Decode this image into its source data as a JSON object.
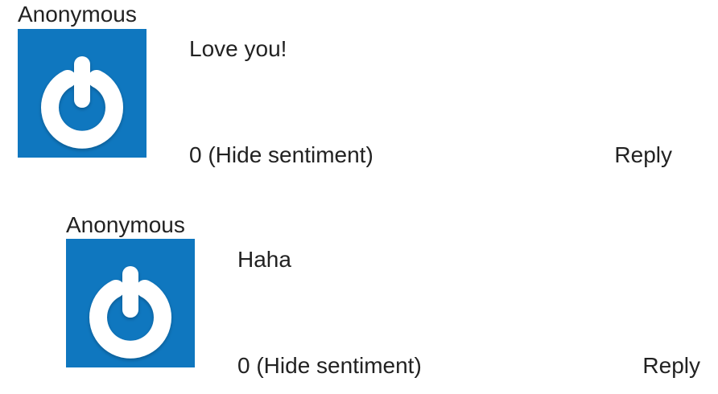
{
  "comments": [
    {
      "author": "Anonymous",
      "avatar_icon": "power-icon",
      "text": "Love you!",
      "vote_count": "0",
      "sentiment_toggle": "(Hide sentiment)",
      "reply_label": "Reply"
    },
    {
      "author": "Anonymous",
      "avatar_icon": "power-icon",
      "text": "Haha",
      "vote_count": "0",
      "sentiment_toggle": "(Hide sentiment)",
      "reply_label": "Reply"
    }
  ],
  "colors": {
    "avatar_background": "#0f77bf",
    "avatar_icon": "#ffffff",
    "text": "#222222"
  }
}
